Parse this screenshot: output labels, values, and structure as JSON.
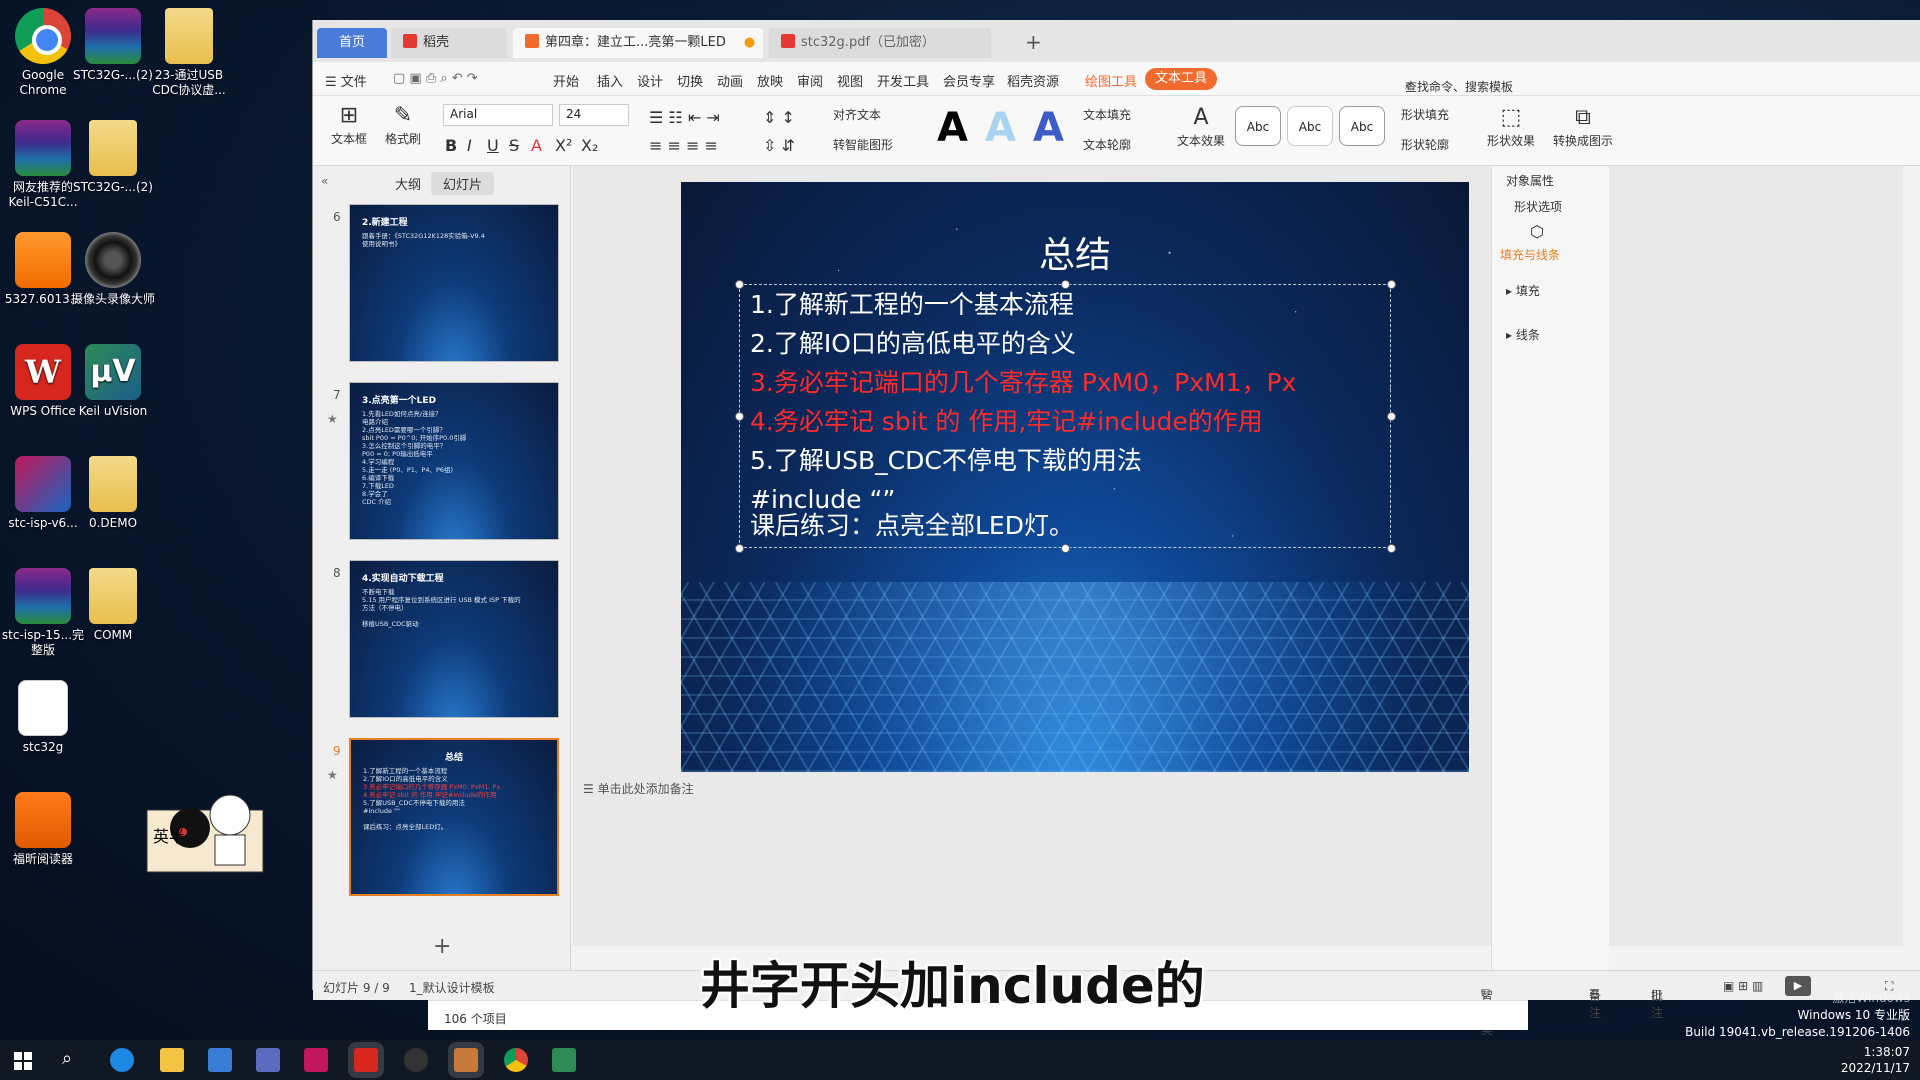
{
  "desktop": {
    "icons": [
      {
        "label": "Google Chrome"
      },
      {
        "label": "STC32G-...(2)"
      },
      {
        "label": "23-通过USB CDC协议虚..."
      },
      {
        "label": "网友推荐的 Keil-C51C..."
      },
      {
        "label": "STC32G-...(2)"
      },
      {
        "label": "5327.6013..."
      },
      {
        "label": "摄像头录像大师"
      },
      {
        "label": "WPS Office"
      },
      {
        "label": "Keil uVision"
      },
      {
        "label": "stc-isp-v6..."
      },
      {
        "label": "0.DEMO"
      },
      {
        "label": "stc-isp-15...完整版"
      },
      {
        "label": "COMM"
      },
      {
        "label": "stc32g"
      },
      {
        "label": "福昕阅读器"
      }
    ],
    "sticker_text": "英半"
  },
  "window": {
    "tabs": {
      "home": "首页",
      "shell": "稻壳",
      "doc": "第四章：建立工...亮第一颗LED",
      "pdf": "stc32g.pdf（已加密）"
    },
    "menu": {
      "file": "文件",
      "items": [
        "开始",
        "插入",
        "设计",
        "切换",
        "动画",
        "放映",
        "审阅",
        "视图",
        "开发工具",
        "会员专享",
        "稻壳资源"
      ],
      "drawing_tools": "绘图工具",
      "text_tools": "文本工具",
      "search_placeholder": "查找命令、搜索模板"
    },
    "ribbon": {
      "textbox": "文本框",
      "format_painter": "格式刷",
      "font": "Arial",
      "size": "24",
      "align_text": "对齐文本",
      "smart_shape": "转智能图形",
      "text_fill": "文本填充",
      "text_outline": "文本轮廓",
      "text_effect": "文本效果",
      "style_label": "Abc",
      "shape_fill": "形状填充",
      "shape_outline": "形状轮廓",
      "shape_effect": "形状效果",
      "convert_graphic": "转换成图示"
    }
  },
  "panel": {
    "tab_outline": "大纲",
    "tab_slides": "幻灯片",
    "slides": [
      {
        "num": "6",
        "title": "2.新建工程",
        "lines": [
          "跟着手册：《STC32G12K128实验箱-V9.4",
          "使用说明书》"
        ]
      },
      {
        "num": "7",
        "title": "3.点亮第一个LED",
        "lines": [
          "1.先看LED如何点亮/连接？",
          "  电路介绍",
          "2.点亮LED需要哪一个引脚？",
          "  sbit P00 = P0^0;    开始序P0.0引脚",
          "3.怎么控制这个引脚的电平？",
          "  P00 = 0;       P0输出低电平",
          "4.学习编程",
          "5.走一走 (P0、P1、P4、P6组)",
          "6.编译下载",
          "7.下载LED",
          "8.学会了",
          "  CDC 介绍"
        ]
      },
      {
        "num": "8",
        "title": "4.实现自动下载工程",
        "lines": [
          "不断电下载",
          "5.15 用户程序复位到系统区进行 USB 模式 ISP 下载的",
          "方法（不停电）",
          "",
          "移植USB_CDC驱动"
        ]
      },
      {
        "num": "9",
        "title": "总结",
        "lines": [
          "1.了解新工程的一个基本流程",
          "2.了解IO口的高低电平的含义",
          "3.务必牢记端口的几个寄存器 PxM0, PxM1, Px",
          "4.务必牢记 sbit 的 作用,牢记#include的作用",
          "5.了解USB_CDC不停电下载的用法",
          "#include \"\"",
          "",
          "课后练习：点亮全部LED灯。"
        ]
      }
    ]
  },
  "slide": {
    "title": "总结",
    "lines": [
      "1.了解新工程的一个基本流程",
      "2.了解IO口的高低电平的含义",
      "3.务必牢记端口的几个寄存器 PxM0，PxM1，Px",
      "4.务必牢记 sbit 的 作用,牢记#include的作用",
      "5.了解USB_CDC不停电下载的用法",
      "#include “”",
      "课后练习：点亮全部LED灯。"
    ],
    "notes_placeholder": "单击此处添加备注"
  },
  "rightpanel": {
    "title": "对象属性",
    "shape_options": "形状选项",
    "fill_line": "填充与线条",
    "fill": "填充",
    "line": "线条"
  },
  "status": {
    "slide_count": "幻灯片 9 / 9",
    "template": "1_默认设计模板",
    "beautify": "智能美化",
    "notes": "备注",
    "comments": "批注"
  },
  "subtitle": "井字开头加include的",
  "explorer": {
    "item_count": "106 个项目"
  },
  "system": {
    "activation_hint": "激活Windows",
    "os": "Windows 10 专业版",
    "build": "Build 19041.vb_release.191206-1406",
    "time": "1:38:07",
    "date": "2022/11/17"
  },
  "colors": {
    "accent_blue": "#4a7bd8",
    "text_tools_pill": "#f26b2e",
    "slide_red": "#ff2a2a",
    "current_thumb": "#e67e22"
  }
}
